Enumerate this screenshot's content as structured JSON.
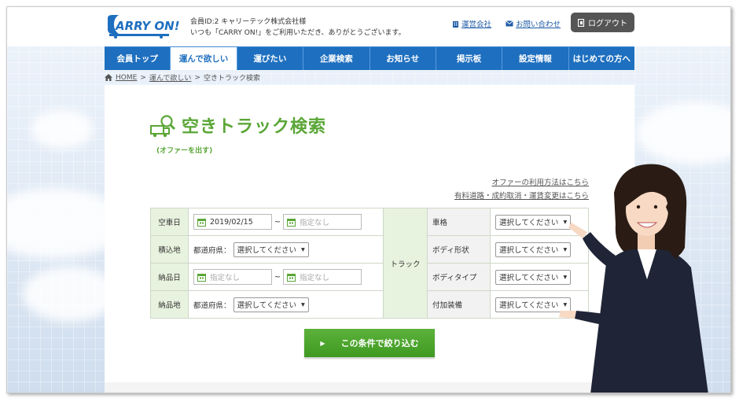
{
  "header": {
    "logo_text": "CARRY ON!",
    "member_line1": "会員ID:2 キャリーテック株式会社様",
    "member_line2": "いつも「CARRY ON!」をご利用いただき、ありがとうございます。",
    "links": [
      {
        "label": "運営会社",
        "icon": "building-icon"
      },
      {
        "label": "お問い合わせ",
        "icon": "mail-icon"
      }
    ],
    "logout_label": "ログアウト"
  },
  "nav": {
    "items": [
      "会員トップ",
      "運んで欲しい",
      "運びたい",
      "企業検索",
      "お知らせ",
      "掲示板",
      "設定情報",
      "はじめての方へ"
    ],
    "active_index": 1
  },
  "breadcrumb": {
    "home": "HOME",
    "sep": ">",
    "parent": "運んで欲しい",
    "current": "空きトラック検索"
  },
  "page": {
    "title": "空きトラック検索",
    "subtitle": "(オファーを出す)",
    "help_link1": "オファーの利用方法はこちら",
    "help_link2": "有料道路・成約取消・運賃変更はこちら"
  },
  "form": {
    "empty_date_label": "空車日",
    "empty_date_from": "2019/02/15",
    "empty_date_to_placeholder": "指定なし",
    "tilde": "~",
    "loading_label": "積込地",
    "prefecture_label": "都道府県：",
    "select_default": "選択してください",
    "delivery_date_label": "納品日",
    "delivery_from_placeholder": "指定なし",
    "delivery_to_placeholder": "指定なし",
    "delivery_place_label": "納品地",
    "truck_group_label": "トラック",
    "truck_fields": [
      "車格",
      "ボディ形状",
      "ボディタイプ",
      "付加装備"
    ],
    "submit_label": "この条件で絞り込む"
  },
  "colors": {
    "nav_blue": "#1e6fbf",
    "accent_green": "#5aa637",
    "button_green": "#4aa52a",
    "label_bg": "#e8f3df"
  }
}
